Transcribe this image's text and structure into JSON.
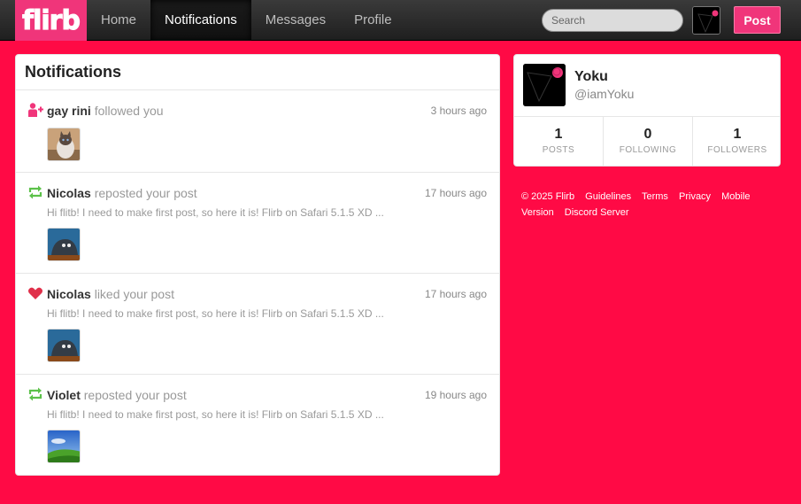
{
  "brand": {
    "logo_text": "flirb",
    "accent": "#f0357a",
    "background": "#ff0a45"
  },
  "nav": [
    {
      "label": "Home"
    },
    {
      "label": "Notifications"
    },
    {
      "label": "Messages"
    },
    {
      "label": "Profile"
    }
  ],
  "search": {
    "placeholder": "Search"
  },
  "topbar": {
    "post_label": "Post"
  },
  "notifications": {
    "title": "Notifications",
    "items": [
      {
        "type": "follow",
        "icon": "add-user-icon",
        "user": "gay rini",
        "action": "followed you",
        "time": "3 hours ago",
        "snippet": ""
      },
      {
        "type": "repost",
        "icon": "repost-icon",
        "user": "Nicolas",
        "action": "reposted your post",
        "time": "17 hours ago",
        "snippet": "Hi flitb! I need to make first post, so here it is! Flirb on Safari 5.1.5 XD ..."
      },
      {
        "type": "like",
        "icon": "heart-icon",
        "user": "Nicolas",
        "action": "liked your post",
        "time": "17 hours ago",
        "snippet": "Hi flitb! I need to make first post, so here it is! Flirb on Safari 5.1.5 XD ..."
      },
      {
        "type": "repost",
        "icon": "repost-icon",
        "user": "Violet",
        "action": "reposted your post",
        "time": "19 hours ago",
        "snippet": "Hi flitb! I need to make first post, so here it is! Flirb on Safari 5.1.5 XD ..."
      }
    ]
  },
  "profile": {
    "name": "Yoku",
    "handle": "@iamYoku",
    "stats": [
      {
        "value": "1",
        "label": "POSTS"
      },
      {
        "value": "0",
        "label": "FOLLOWING"
      },
      {
        "value": "1",
        "label": "FOLLOWERS"
      }
    ]
  },
  "footer": {
    "copyright": "© 2025 Flirb",
    "links": [
      "Guidelines",
      "Terms",
      "Privacy",
      "Mobile Version",
      "Discord Server"
    ]
  }
}
